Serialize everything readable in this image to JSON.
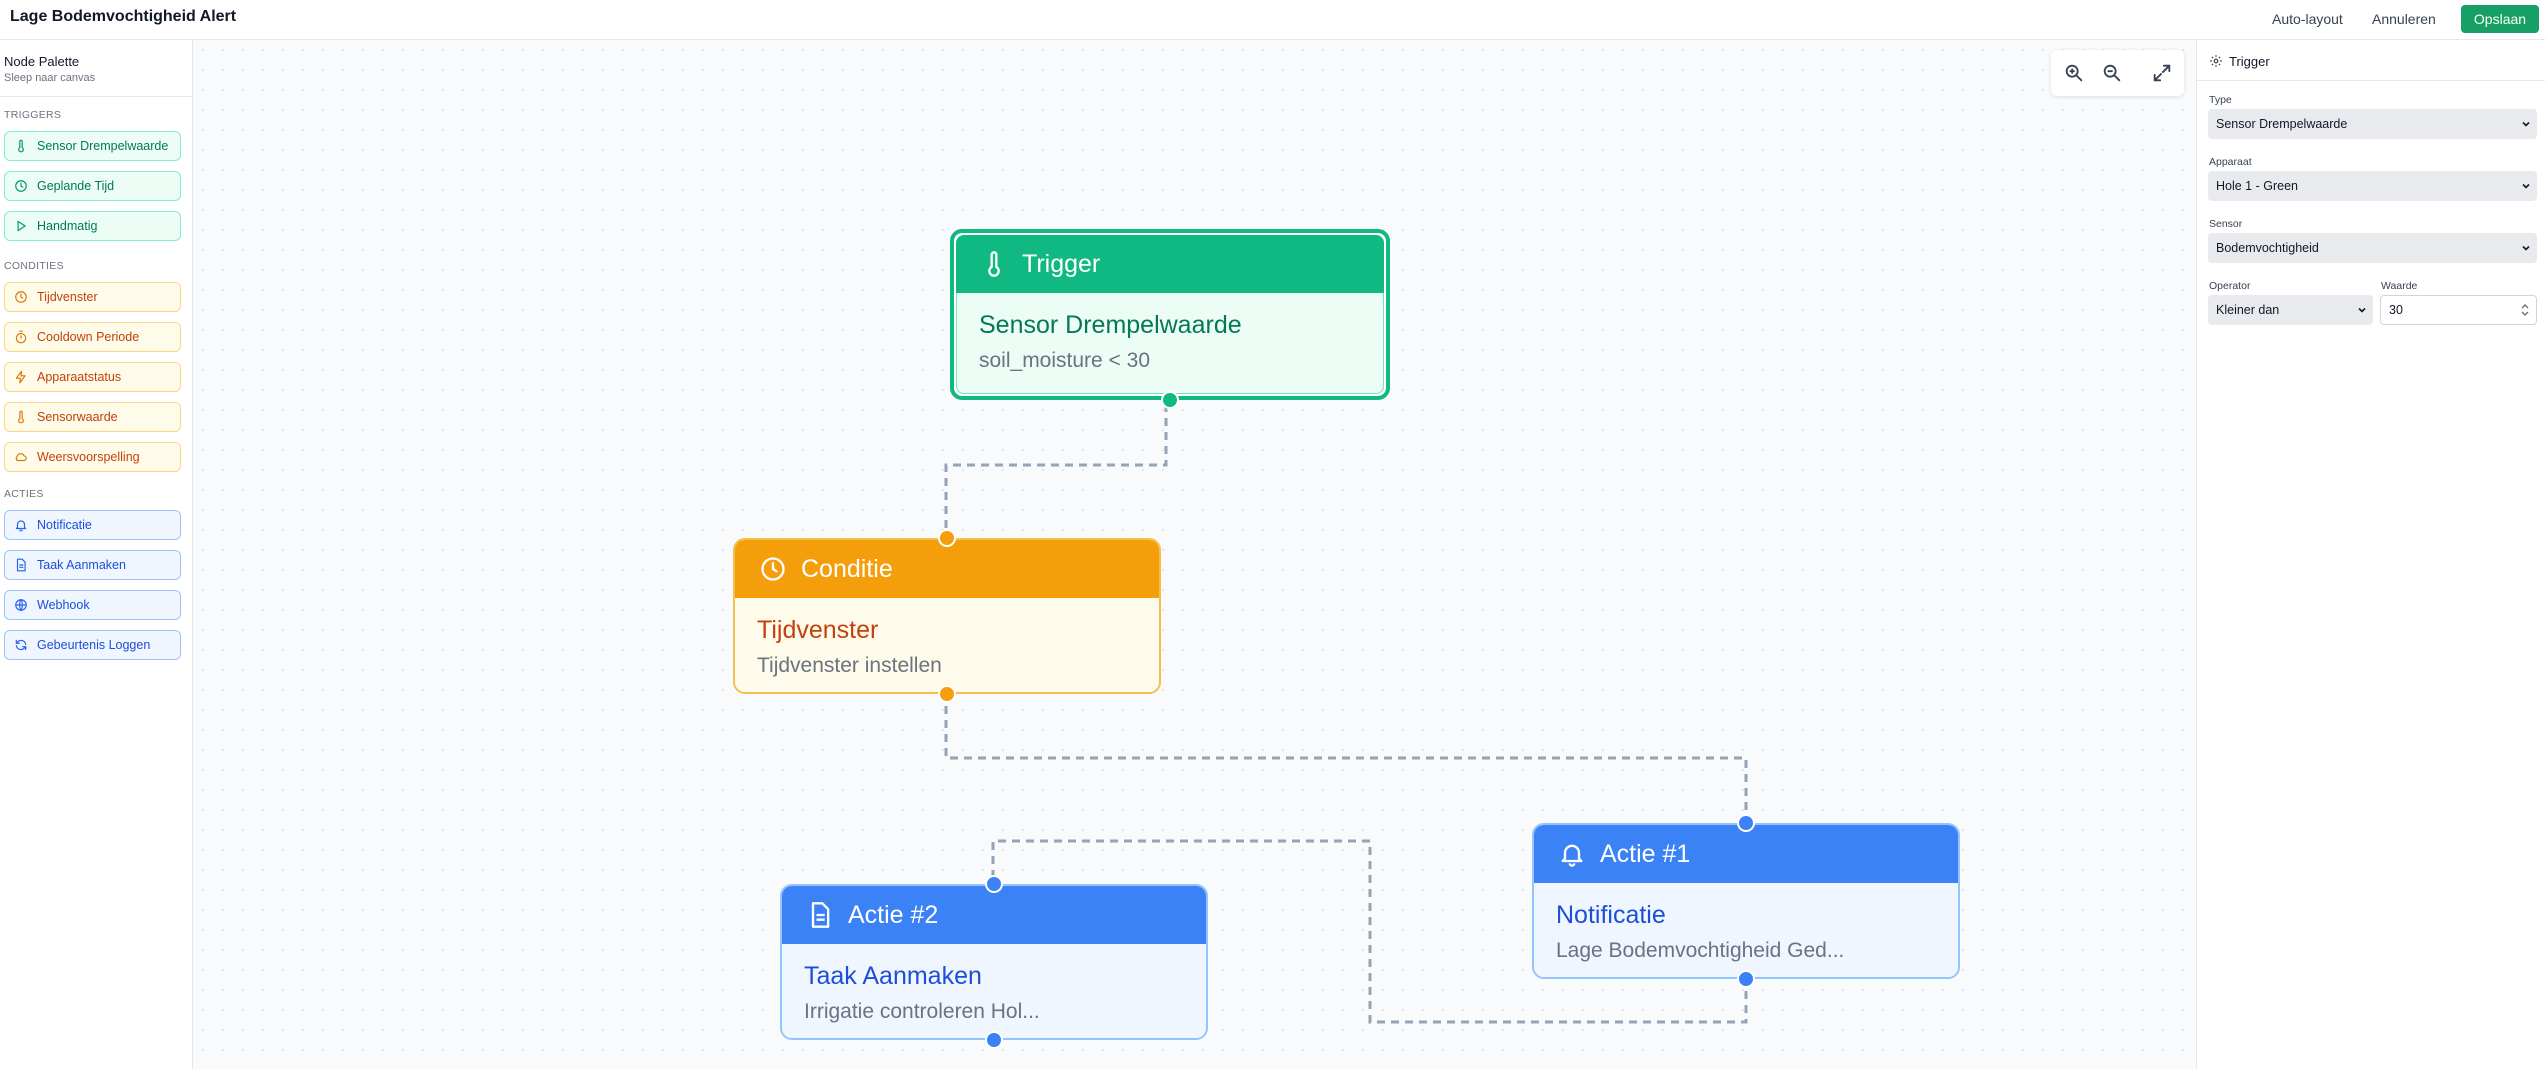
{
  "header": {
    "title": "Lage Bodemvochtigheid Alert",
    "auto_layout": "Auto-layout",
    "cancel": "Annuleren",
    "save": "Opslaan"
  },
  "palette": {
    "title": "Node Palette",
    "subtitle": "Sleep naar canvas",
    "triggers_label": "TRIGGERS",
    "triggers": [
      {
        "label": "Sensor Drempelwaarde",
        "icon": "thermometer-icon"
      },
      {
        "label": "Geplande Tijd",
        "icon": "clock-icon"
      },
      {
        "label": "Handmatig",
        "icon": "play-icon"
      }
    ],
    "conditions_label": "CONDITIES",
    "conditions": [
      {
        "label": "Tijdvenster",
        "icon": "clock-icon"
      },
      {
        "label": "Cooldown Periode",
        "icon": "timer-icon"
      },
      {
        "label": "Apparaatstatus",
        "icon": "zap-icon"
      },
      {
        "label": "Sensorwaarde",
        "icon": "thermometer-icon"
      },
      {
        "label": "Weersvoorspelling",
        "icon": "cloud-icon"
      }
    ],
    "actions_label": "ACTIES",
    "actions": [
      {
        "label": "Notificatie",
        "icon": "bell-icon"
      },
      {
        "label": "Taak Aanmaken",
        "icon": "file-icon"
      },
      {
        "label": "Webhook",
        "icon": "globe-icon"
      },
      {
        "label": "Gebeurtenis Loggen",
        "icon": "refresh-icon"
      }
    ]
  },
  "canvas": {
    "nodes": {
      "trigger": {
        "header": "Trigger",
        "title": "Sensor Drempelwaarde",
        "subtitle": "soil_moisture < 30",
        "icon": "thermometer-icon",
        "color": "#10b981"
      },
      "condition": {
        "header": "Conditie",
        "title": "Tijdvenster",
        "subtitle": "Tijdvenster instellen",
        "icon": "clock-icon",
        "color": "#f59e0b"
      },
      "action1": {
        "header": "Actie #1",
        "title": "Notificatie",
        "subtitle": "Lage Bodemvochtigheid Ged...",
        "icon": "bell-icon",
        "color": "#3b82f6"
      },
      "action2": {
        "header": "Actie #2",
        "title": "Taak Aanmaken",
        "subtitle": "Irrigatie controleren Hol...",
        "icon": "file-icon",
        "color": "#3b82f6"
      }
    },
    "zoom_controls": [
      "zoom-in-icon",
      "zoom-out-icon",
      "fit-view-icon"
    ]
  },
  "properties": {
    "header": "Trigger",
    "type_label": "Type",
    "type_value": "Sensor Drempelwaarde",
    "device_label": "Apparaat",
    "device_value": "Hole 1 - Green",
    "sensor_label": "Sensor",
    "sensor_value": "Bodemvochtigheid",
    "operator_label": "Operator",
    "operator_value": "Kleiner dan",
    "value_label": "Waarde",
    "value_value": "30"
  }
}
